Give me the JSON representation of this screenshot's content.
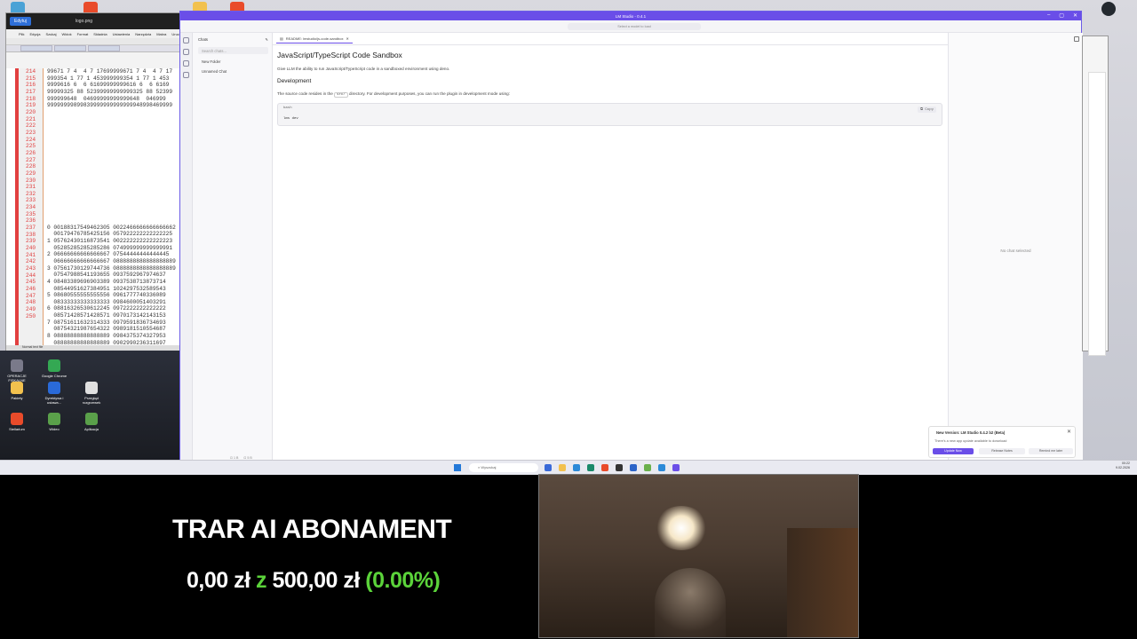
{
  "notepad": {
    "tab_button": "Edytuj",
    "title": "logo.png",
    "menu": [
      "Plik",
      "Edycja",
      "Szukaj",
      "Widok",
      "Format",
      "Składnia",
      "Ustawienia",
      "Narzędzia",
      "Makra",
      "Uruc"
    ],
    "line_numbers": [
      "214",
      "215",
      "216",
      "217",
      "218",
      "219",
      "220",
      "221",
      "222",
      "223",
      "224",
      "225",
      "226",
      "227",
      "228",
      "229",
      "230",
      "231",
      "232",
      "233",
      "234",
      "235",
      "236",
      "237",
      "238",
      "239",
      "240",
      "241",
      "242",
      "243",
      "244",
      "245",
      "246",
      "247",
      "248",
      "249",
      "250"
    ],
    "code_lines": [
      "99671 7 4  4 7 17699999671 7 4  4 7 17",
      "999354 1 77 1 453999999354 1 77 1 453",
      "9999616 6  6 61699999999616 6  6 6169",
      "99999325 88 52399999999999325 88 52399",
      "999999648  04699999999999648  046999",
      "99999999899839999999999999948998469999",
      "",
      "",
      "",
      "",
      "",
      "",
      "",
      "",
      "",
      "",
      "",
      "",
      "",
      "",
      "",
      "",
      "",
      "0 00188317549462305 0022466666666666662",
      "  00179476785425156 057922222222222225",
      "1 05762430116873541 002222222222222223",
      "  05285285285285286 074999999999999991",
      "2 06666666666666667 07544444444444445",
      "  06666666666666667 0888888888888888889",
      "3 07561730129744736 0888888888888888889",
      "  07547988541193655 0937592967974637",
      "4 08483389696903389 0937538713873714",
      "  08544951627384951 1024297532589543",
      "5 08680555555555556 0961777740336089",
      "  08333333333333333 0984600051403291",
      "6 08816326530612245 0972222222222222",
      "  08571428571428571 0970173142143153",
      "7 08751611632314333 0979591836734693",
      "  08754321987654322 0989181510554687",
      "8 08888888888888889 0984375374327953",
      "  08888888888888889 0902990236311697"
    ],
    "status": "Normal text file"
  },
  "desktop": {
    "icons": [
      "OPERACJE FISKALNE",
      "Google Chrome",
      "Pakiety",
      "Dyrektywa i ustawa...",
      "Przegląd rozgrzewek",
      "Stellarium",
      "Wideo",
      "Aplikacja"
    ]
  },
  "lmstudio": {
    "title": "LM Studio - 0.4.1",
    "model_placeholder": "Select a model to load",
    "sidebar": {
      "heading": "Chats",
      "search_placeholder": "Search chats...",
      "new_folder": "New Folder",
      "chat_item": "Unnamed Chat",
      "footer": [
        "⊡ 1 B",
        "⊡ 5 B"
      ]
    },
    "tab_label": "README: lmstudio/js-code-sandbox",
    "doc": {
      "h1": "JavaScript/TypeScript Code Sandbox",
      "intro": "Give LLM the ability to run JavaScript/TypeScript code in a sandboxed environment using deno.",
      "h2": "Development",
      "dev_text_a": "The source code resides in the",
      "dev_code": "src/",
      "dev_text_b": "directory. For development purposes, you can run the plugin in development mode using:",
      "code_lang": "bash",
      "copy": "Copy",
      "code_cmd": "lms dev"
    },
    "right_panel": {
      "no_chat": "No chat selected"
    }
  },
  "toast": {
    "title": "New Version: LM Studio 0.4.2 b2 (Beta)",
    "body": "There's a new app update available to download",
    "btn_update": "Update Now",
    "btn_notes": "Release Notes",
    "btn_remind": "Remind me later"
  },
  "taskbar": {
    "search": "Wyszukaj",
    "time": "00:22",
    "date": "9.02.2026"
  },
  "overlay": {
    "title": "TRAR AI ABONAMENT",
    "amount_current": "0,00 zł",
    "amount_connector": "z",
    "amount_target": "500,00 zł",
    "percent": "(0.00%)"
  },
  "colors": {
    "accent": "#6a4ee8",
    "progress_green": "#5bd33a"
  }
}
